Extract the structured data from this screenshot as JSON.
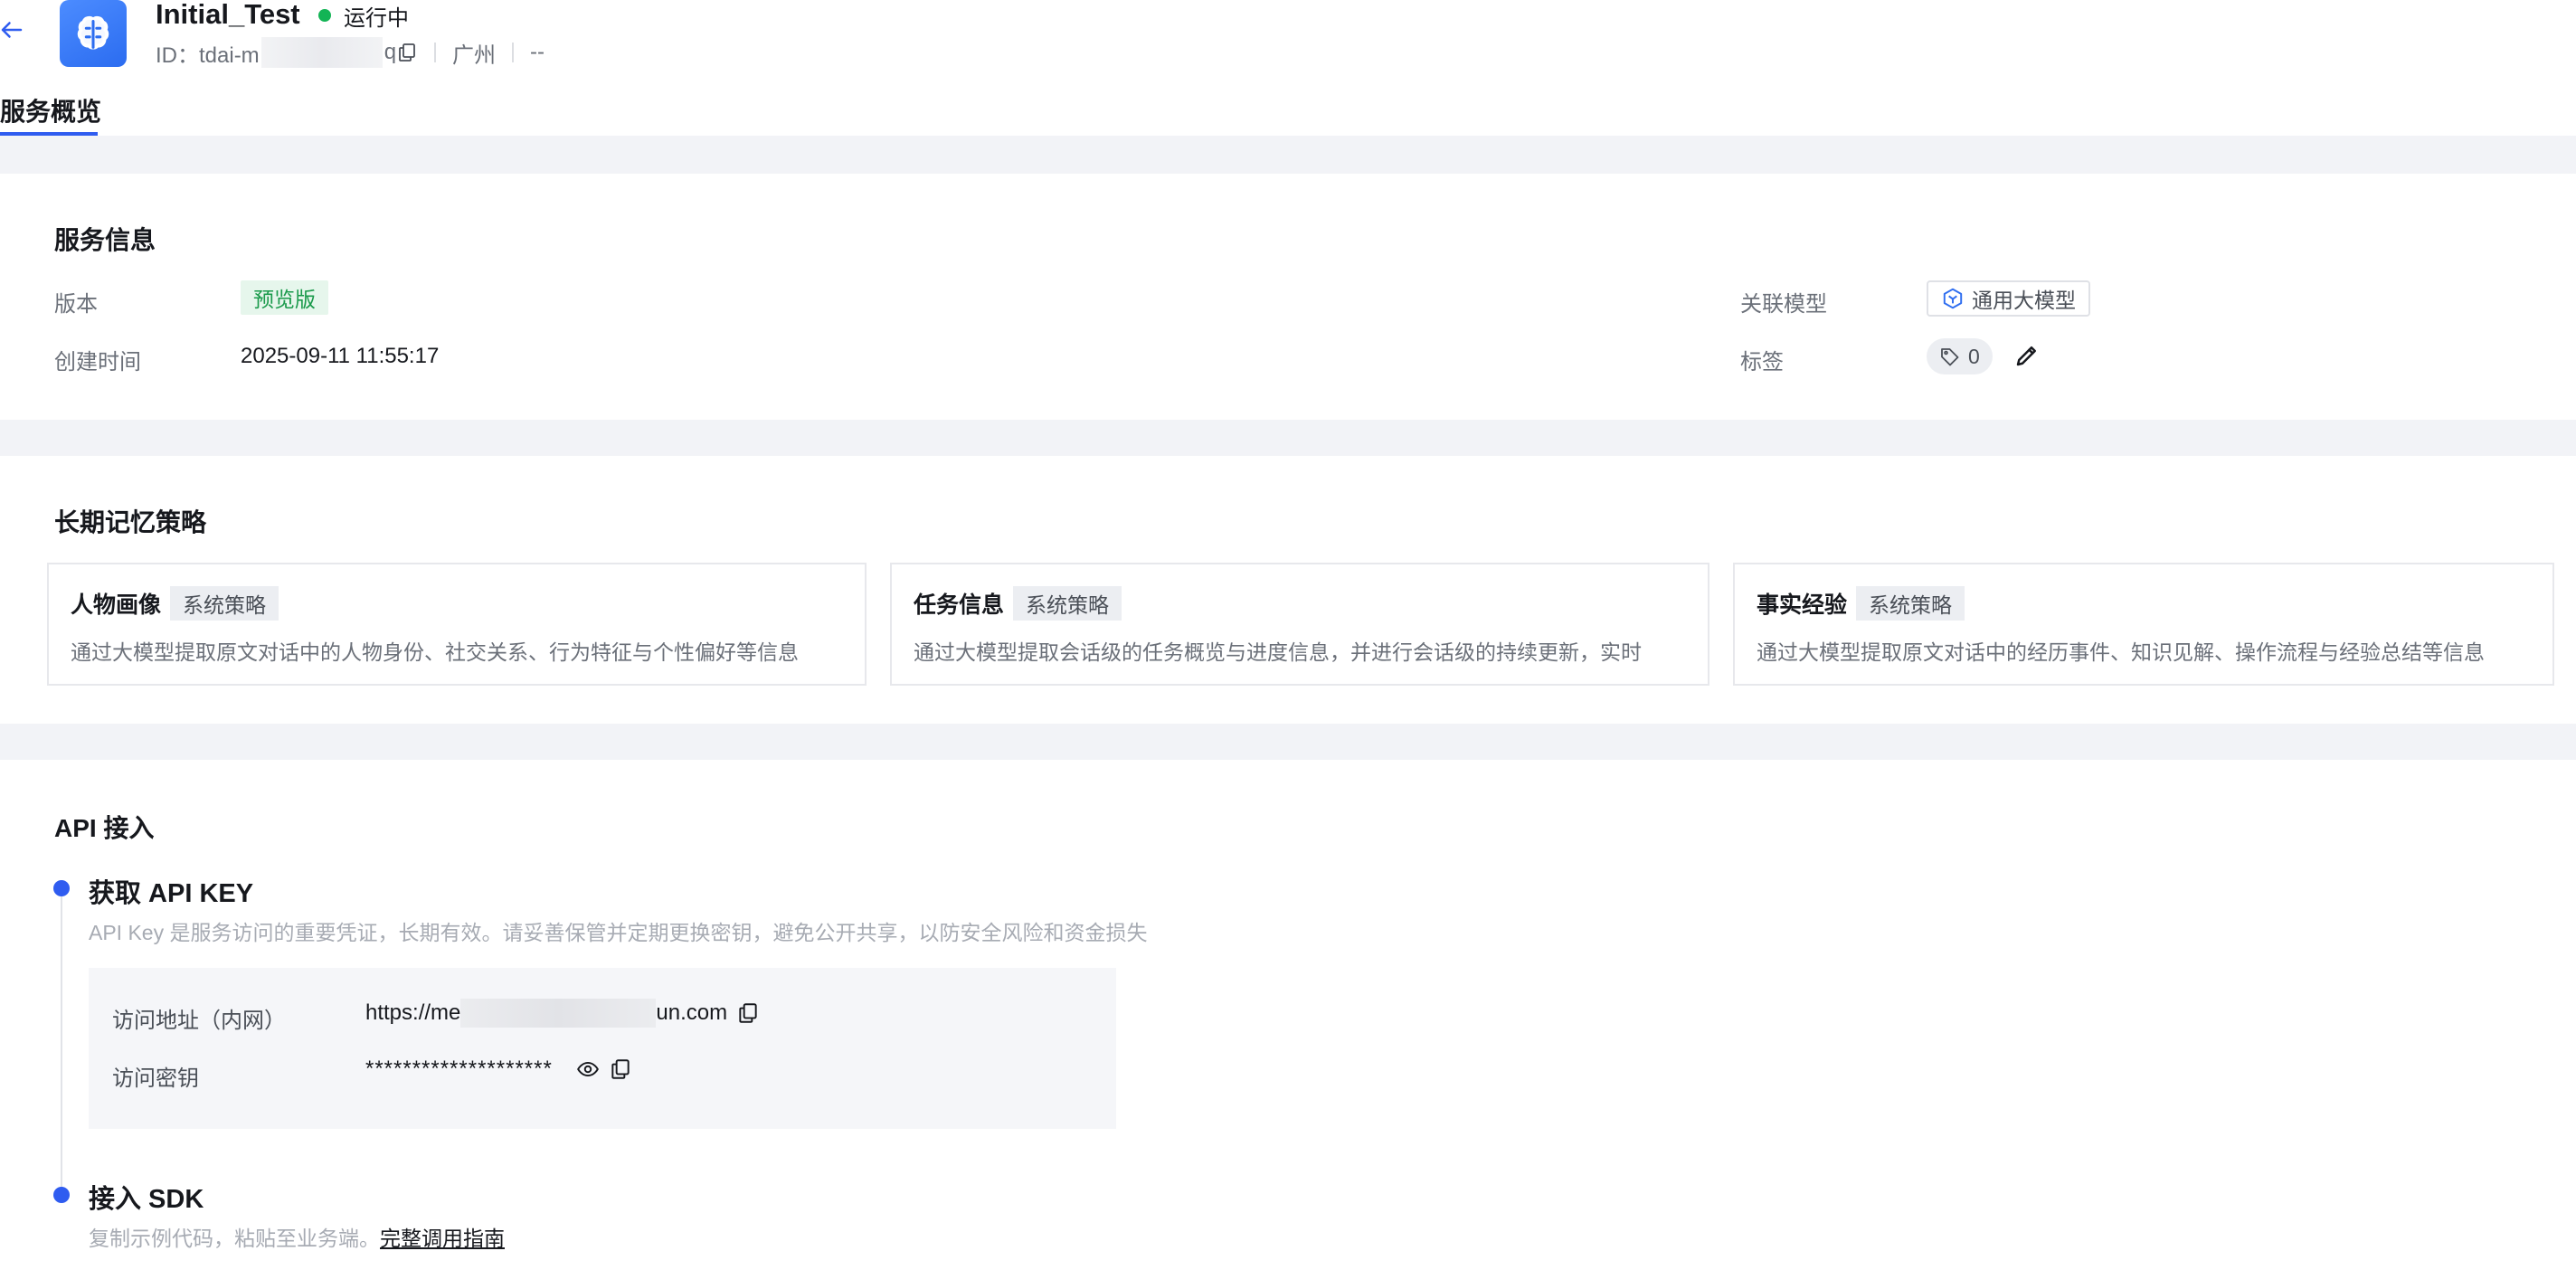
{
  "header": {
    "app_name": "Initial_Test",
    "status": "运行中",
    "id_prefix": "ID：tdai-m",
    "id_suffix": "q",
    "region": "广州",
    "extra": "--",
    "tab": "服务概览"
  },
  "service_info": {
    "title": "服务信息",
    "version_label": "版本",
    "version_value": "预览版",
    "created_label": "创建时间",
    "created_value": "2025-09-11 11:55:17",
    "model_label": "关联模型",
    "model_value": "通用大模型",
    "tags_label": "标签",
    "tags_count": "0"
  },
  "memory_strategy": {
    "title": "长期记忆策略",
    "cards": [
      {
        "name": "人物画像",
        "badge": "系统策略",
        "desc": "通过大模型提取原文对话中的人物身份、社交关系、行为特征与个性偏好等信息"
      },
      {
        "name": "任务信息",
        "badge": "系统策略",
        "desc": "通过大模型提取会话级的任务概览与进度信息，并进行会话级的持续更新，实时"
      },
      {
        "name": "事实经验",
        "badge": "系统策略",
        "desc": "通过大模型提取原文对话中的经历事件、知识见解、操作流程与经验总结等信息"
      }
    ]
  },
  "api_access": {
    "title": "API 接入",
    "step1_title": "获取 API KEY",
    "step1_desc": "API Key 是服务访问的重要凭证，长期有效。请妥善保管并定期更换密钥，避免公开共享，以防安全风险和资金损失",
    "url_label": "访问地址（内网）",
    "url_prefix": "https://me",
    "url_suffix": "un.com",
    "key_label": "访问密钥",
    "key_value": "********************",
    "step2_title": "接入 SDK",
    "step2_desc": "复制示例代码，粘贴至业务端。",
    "step2_link": "完整调用指南"
  },
  "colors": {
    "accent": "#2f5cf0",
    "status_running": "#13b455",
    "preview_badge_bg": "#e6f6ec",
    "preview_badge_text": "#1a9a4b",
    "page_gap": "#f2f3f7"
  },
  "icons": [
    "back-arrow-icon",
    "brain-logo-icon",
    "copy-icon",
    "model-cube-icon",
    "tag-icon",
    "edit-pencil-icon",
    "eye-icon"
  ]
}
